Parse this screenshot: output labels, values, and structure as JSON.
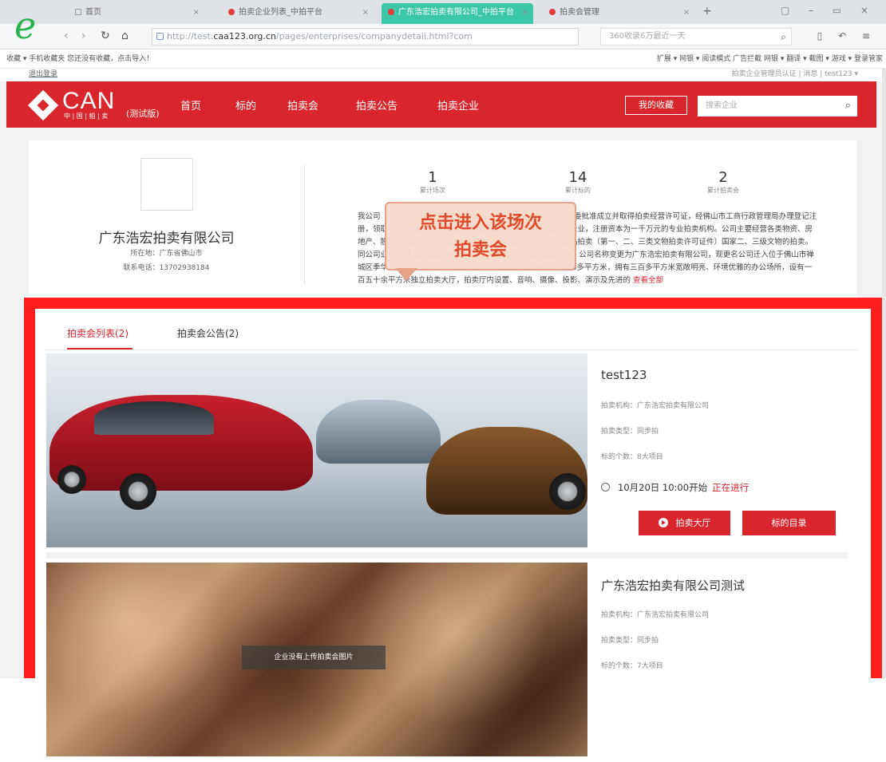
{
  "browser": {
    "tabs": [
      {
        "label": "首页",
        "icon": "page-icon"
      },
      {
        "label": "拍卖企业列表_中拍平台",
        "icon": "red-dot-icon"
      },
      {
        "label": "广东浩宏拍卖有限公司_中拍平台",
        "icon": "red-dot-icon"
      },
      {
        "label": "拍卖会管理",
        "icon": "red-dot-icon"
      }
    ],
    "url_prefix": "http://test.",
    "url_domain": "caa123.org.cn",
    "url_path": "/pages/enterprises/companydetail.html?com",
    "search_placeholder": "360收录6万最近一天",
    "bookmarks_left": "收藏 ▾   手机收藏夹   您还没有收藏，点击导入！",
    "bookmarks_right": "扩展 ▾   网银 ▾   阅读模式   广告拦截   网银 ▾   翻译 ▾   截图 ▾   游戏 ▾   登录管家"
  },
  "site": {
    "topinfo_left": "退出登录",
    "topinfo_right": "拍卖企业管理员认证   |   消息   |   test123 ▾",
    "logo_text": "CAN",
    "logo_sub": "中 | 国 | 拍 | 卖",
    "logo_beta": "(测试版)",
    "nav": [
      "首页",
      "标的",
      "拍卖会",
      "拍卖公告",
      "拍卖企业"
    ],
    "my_collect": "我的收藏",
    "search_placeholder": "搜索企业"
  },
  "company": {
    "name": "广东浩宏拍卖有限公司",
    "location": "所在地：广东省佛山市",
    "phone": "联系电话：13702938184",
    "stats": [
      {
        "value": "1",
        "label": "累计场次"
      },
      {
        "value": "14",
        "label": "累计标的"
      },
      {
        "value": "2",
        "label": "累计拍卖会"
      }
    ],
    "description": "我公司（原名佛山市浩宏拍卖有限公司）于1996年经广东省经贸委批准成立并取得拍卖经营许可证，经佛山市工商行政管理局办理登记注册，领取营业执照，是在佛山市较早开展拍卖业务的综合性拍卖企业，注册资本为一千万元的专业拍卖机构。公司主要经营各类物资、房地产、股权等动产、不动产的拍卖业务，同时可以开展文物艺术品拍卖（第一、二、三类文物拍卖许可证件）国家二、三级文物的拍卖。同公司业务发展，2007年3月经广东省对外贸易经济合作厅批准，公司名称变更为广东浩宏拍卖有限公司，现更名公司迁入位于佛山市禅城区季华五路的写字楼，同时在佛山拥有自己的拍卖厅面积约640多平方米，拥有三百多平方米宽敞明亮、环境优雅的办公场所，设有一百五十余平方米独立拍卖大厅，拍卖厅内设置、音响、摄像、投影、演示及先进的",
    "more": "查看全部"
  },
  "tooltip": {
    "line1": "点击进入该场次",
    "line2": "拍卖会"
  },
  "tabs": {
    "list": "拍卖会列表(2)",
    "notice": "拍卖会公告(2)"
  },
  "auctions": [
    {
      "title": "test123",
      "org": "拍卖机构：广东浩宏拍卖有限公司",
      "mode": "拍卖类型：同步拍",
      "count": "标的个数：8大项目",
      "time": "10月20日 10:00开始",
      "status": "正在进行",
      "btn_hall": "拍卖大厅",
      "btn_catalog": "标的目录",
      "image": "cars-photo"
    },
    {
      "title": "广东浩宏拍卖有限公司测试",
      "org": "拍卖机构：广东浩宏拍卖有限公司",
      "mode": "拍卖类型：同步拍",
      "count": "标的个数：7大项目",
      "image_caption": "企业没有上传拍卖会图片",
      "image": "crowd-photo"
    }
  ],
  "colors": {
    "brand_red": "#d8262c",
    "highlight_red": "#ff1f1f",
    "tab_active": "#3cc8a6",
    "tooltip_text": "#e04a2a"
  }
}
